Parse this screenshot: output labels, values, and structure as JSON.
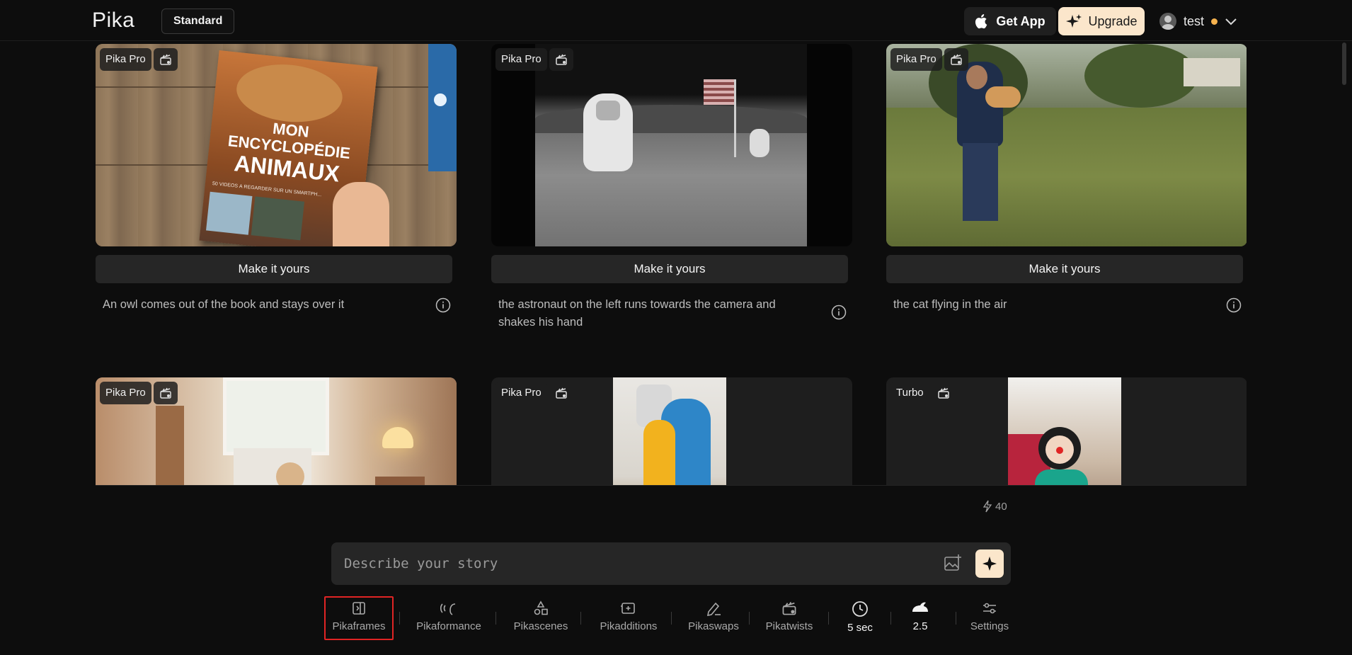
{
  "header": {
    "logo": "Pika",
    "plan": "Standard",
    "get_app": "Get App",
    "upgrade": "Upgrade",
    "username": "test"
  },
  "feed": {
    "cards": [
      {
        "tag": "Pika Pro",
        "action": "Make it yours",
        "caption": "An owl comes out of the book and stays over it",
        "book_title_1": "MON",
        "book_title_2": "ENCYCLOPÉDIE",
        "book_title_3": "ANIMAUX",
        "book_sub": "50 VIDÉOS À REGARDER SUR UN SMARTPH..."
      },
      {
        "tag": "Pika Pro",
        "action": "Make it yours",
        "caption": "the astronaut on the left runs towards the camera and shakes his hand"
      },
      {
        "tag": "Pika Pro",
        "action": "Make it yours",
        "caption": "the cat flying in the air"
      },
      {
        "tag": "Pika Pro"
      },
      {
        "tag": "Pika Pro"
      },
      {
        "tag": "Turbo"
      }
    ]
  },
  "credits": "40",
  "prompt": {
    "placeholder": "Describe your story"
  },
  "tools": [
    {
      "label": "Pikaframes",
      "icon": "frame-icon"
    },
    {
      "label": "Pikaformance",
      "icon": "voice-wave-icon"
    },
    {
      "label": "Pikascenes",
      "icon": "shapes-icon"
    },
    {
      "label": "Pikadditions",
      "icon": "add-image-icon"
    },
    {
      "label": "Pikaswaps",
      "icon": "brush-icon"
    },
    {
      "label": "Pikatwists",
      "icon": "clapper-icon"
    },
    {
      "label": "5 sec",
      "icon": "clock-icon"
    },
    {
      "label": "2.5",
      "icon": "rabbit-icon"
    },
    {
      "label": "Settings",
      "icon": "sliders-icon"
    }
  ],
  "colors": {
    "background": "#0d0d0d",
    "accent": "#fbe6cb",
    "highlight": "#e02424",
    "status_dot": "#f6b24e"
  }
}
